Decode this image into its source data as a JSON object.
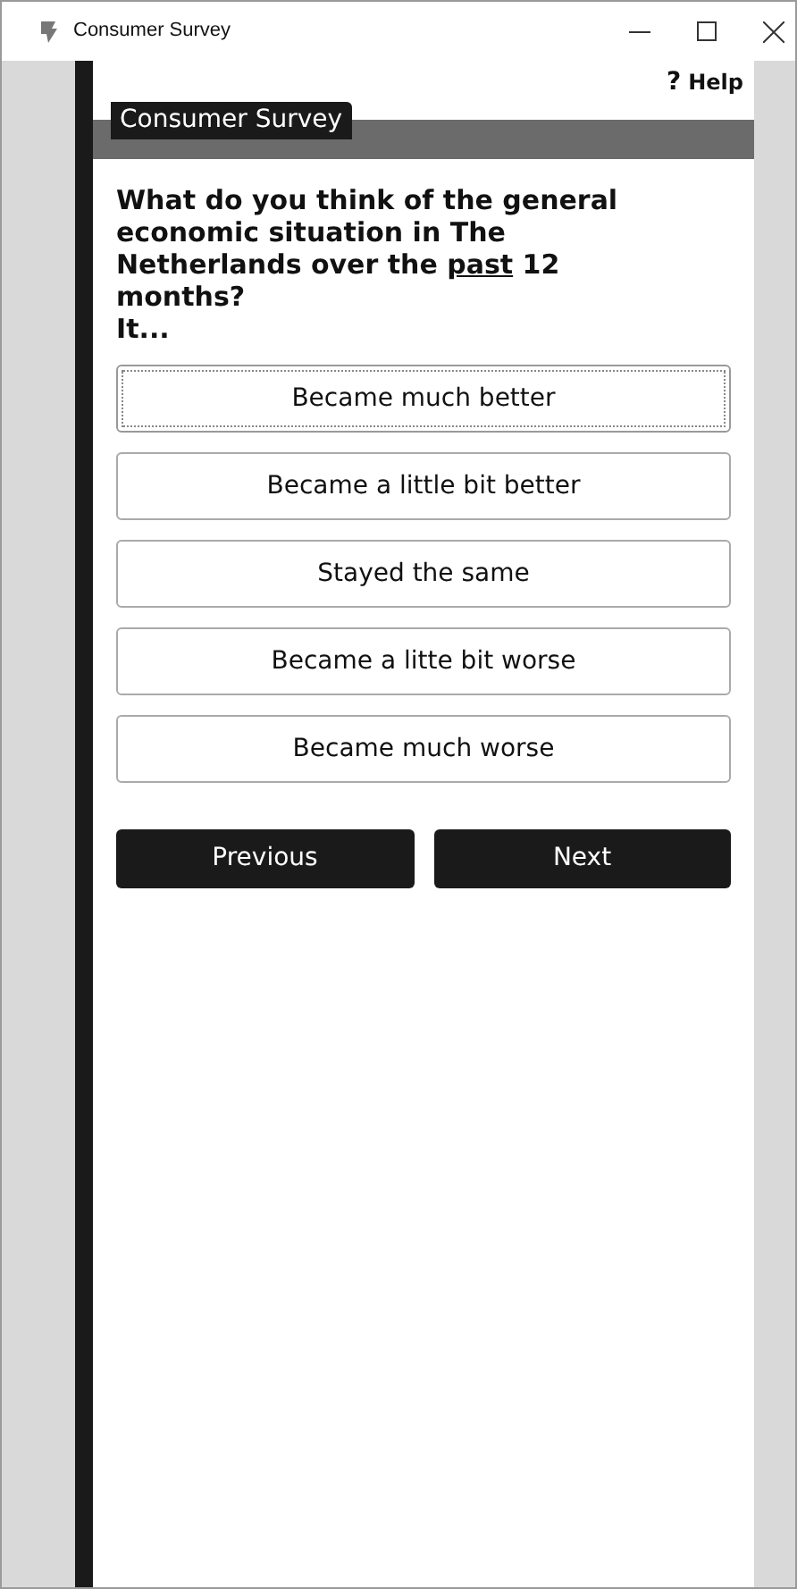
{
  "window": {
    "title": "Consumer Survey"
  },
  "help": {
    "icon": "?",
    "label": "Help"
  },
  "section_tab": "Consumer Survey",
  "question": {
    "parts": [
      {
        "text": "What do you think of the general economic situation in The Netherlands over the ",
        "underline": false
      },
      {
        "text": "past",
        "underline": true
      },
      {
        "text": " 12 months?",
        "underline": false
      }
    ],
    "continuation": "It..."
  },
  "options": [
    {
      "label": "Became much better",
      "focused": true
    },
    {
      "label": "Became a little bit better",
      "focused": false
    },
    {
      "label": "Stayed the same",
      "focused": false
    },
    {
      "label": "Became a litte bit worse",
      "focused": false
    },
    {
      "label": "Became much worse",
      "focused": false
    }
  ],
  "buttons": [
    "Previous",
    "Next"
  ]
}
